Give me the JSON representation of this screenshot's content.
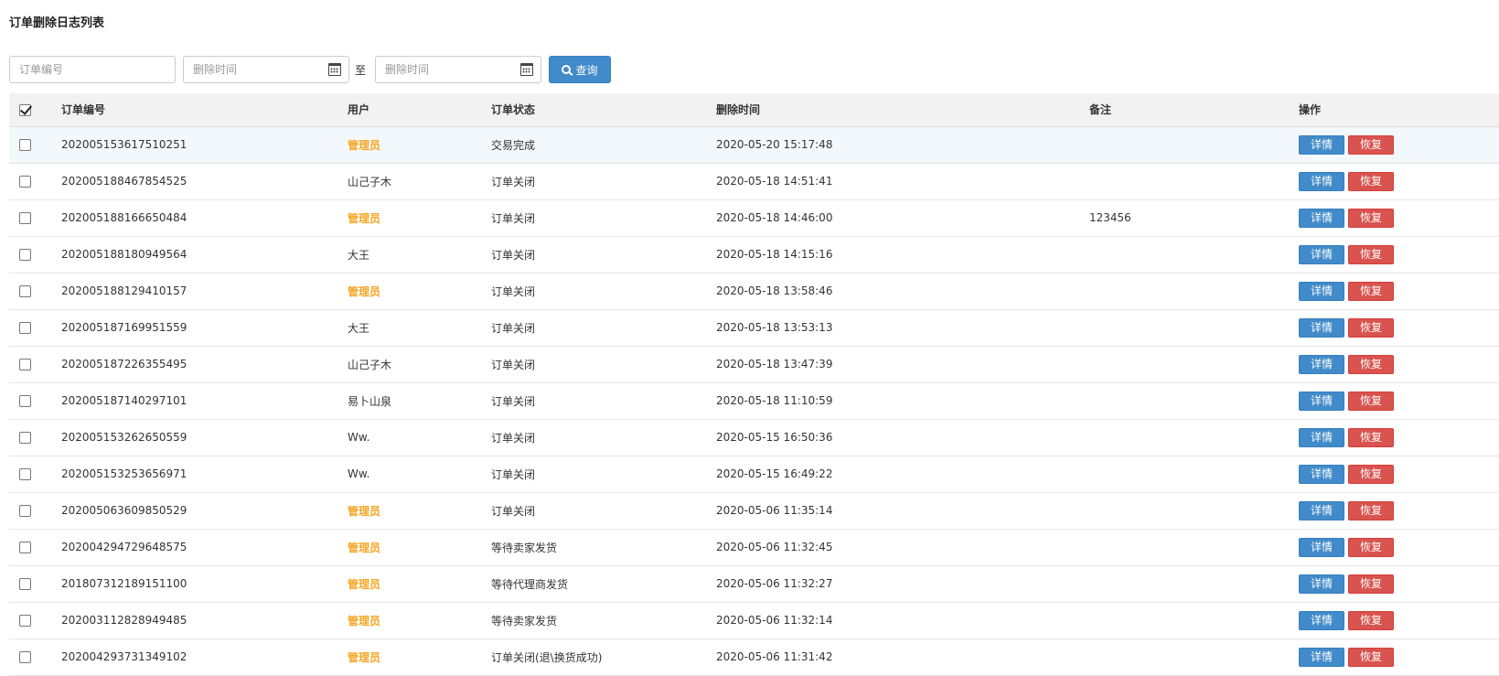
{
  "page_title": "订单删除日志列表",
  "filters": {
    "order_no_placeholder": "订单编号",
    "date_from_placeholder": "删除时间",
    "date_to_placeholder": "删除时间",
    "separator": "至",
    "search_label": "查询"
  },
  "table": {
    "headers": {
      "order_no": "订单编号",
      "user": "用户",
      "status": "订单状态",
      "delete_time": "删除时间",
      "note": "备注",
      "ops": "操作"
    },
    "actions": {
      "detail": "详情",
      "restore": "恢复"
    },
    "rows": [
      {
        "order_no": "202005153617510251",
        "user": "管理员",
        "admin": true,
        "status": "交易完成",
        "delete_time": "2020-05-20 15:17:48",
        "note": ""
      },
      {
        "order_no": "202005188467854525",
        "user": "山己子木",
        "admin": false,
        "status": "订单关闭",
        "delete_time": "2020-05-18 14:51:41",
        "note": ""
      },
      {
        "order_no": "202005188166650484",
        "user": "管理员",
        "admin": true,
        "status": "订单关闭",
        "delete_time": "2020-05-18 14:46:00",
        "note": "123456"
      },
      {
        "order_no": "202005188180949564",
        "user": "大王",
        "admin": false,
        "status": "订单关闭",
        "delete_time": "2020-05-18 14:15:16",
        "note": ""
      },
      {
        "order_no": "202005188129410157",
        "user": "管理员",
        "admin": true,
        "status": "订单关闭",
        "delete_time": "2020-05-18 13:58:46",
        "note": ""
      },
      {
        "order_no": "202005187169951559",
        "user": "大王",
        "admin": false,
        "status": "订单关闭",
        "delete_time": "2020-05-18 13:53:13",
        "note": ""
      },
      {
        "order_no": "202005187226355495",
        "user": "山己子木",
        "admin": false,
        "status": "订单关闭",
        "delete_time": "2020-05-18 13:47:39",
        "note": ""
      },
      {
        "order_no": "202005187140297101",
        "user": "易卜山泉",
        "admin": false,
        "status": "订单关闭",
        "delete_time": "2020-05-18 11:10:59",
        "note": ""
      },
      {
        "order_no": "202005153262650559",
        "user": "Ww.",
        "admin": false,
        "status": "订单关闭",
        "delete_time": "2020-05-15 16:50:36",
        "note": ""
      },
      {
        "order_no": "202005153253656971",
        "user": "Ww.",
        "admin": false,
        "status": "订单关闭",
        "delete_time": "2020-05-15 16:49:22",
        "note": ""
      },
      {
        "order_no": "202005063609850529",
        "user": "管理员",
        "admin": true,
        "status": "订单关闭",
        "delete_time": "2020-05-06 11:35:14",
        "note": ""
      },
      {
        "order_no": "202004294729648575",
        "user": "管理员",
        "admin": true,
        "status": "等待卖家发货",
        "delete_time": "2020-05-06 11:32:45",
        "note": ""
      },
      {
        "order_no": "201807312189151100",
        "user": "管理员",
        "admin": true,
        "status": "等待代理商发货",
        "delete_time": "2020-05-06 11:32:27",
        "note": ""
      },
      {
        "order_no": "202003112828949485",
        "user": "管理员",
        "admin": true,
        "status": "等待卖家发货",
        "delete_time": "2020-05-06 11:32:14",
        "note": ""
      },
      {
        "order_no": "202004293731349102",
        "user": "管理员",
        "admin": true,
        "status": "订单关闭(退\\换货成功)",
        "delete_time": "2020-05-06 11:31:42",
        "note": ""
      }
    ]
  },
  "colors": {
    "primary": "#428bca",
    "danger": "#d9534f",
    "admin_user": "#f5a623"
  }
}
